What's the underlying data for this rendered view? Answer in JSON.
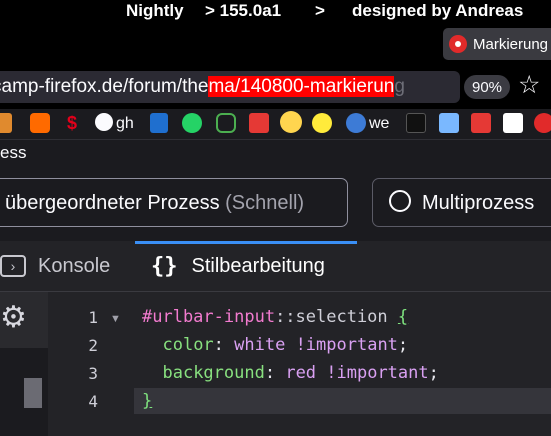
{
  "window": {
    "title_parts": [
      "Nightly",
      "> 155.0a1",
      ">",
      "designed by Andreas"
    ]
  },
  "tab": {
    "label": "Markierung"
  },
  "urlbar": {
    "url_before": "camp-firefox.de/forum/the",
    "url_selected": "ma/140800-markierun",
    "url_after": "g",
    "zoom": "90%"
  },
  "bookmarks": {
    "items": [
      {
        "icon": "folder-icon",
        "color": "#e08a2e"
      },
      {
        "icon": "shop-icon",
        "color": "#ff6a00"
      },
      {
        "icon": "sparkasse-icon",
        "color": "#e2001a"
      },
      {
        "icon": "github-icon",
        "label": "gh"
      },
      {
        "icon": "monitor-icon",
        "color": "#1f6fcf"
      },
      {
        "icon": "whatsapp-icon",
        "color": "#25d366"
      },
      {
        "icon": "leaf-icon",
        "color": "#4caf50"
      },
      {
        "icon": "box-icon",
        "color": "#e53935"
      },
      {
        "icon": "face-icon",
        "color": "#ffd54f"
      },
      {
        "icon": "smiley-icon",
        "color": "#ffeb3b"
      },
      {
        "icon": "globe-icon",
        "label": "we"
      },
      {
        "icon": "cb-icon",
        "color": "#111111"
      },
      {
        "icon": "pencil-icon",
        "color": "#7ab8ff"
      },
      {
        "icon": "red-square-icon",
        "color": "#e53935"
      },
      {
        "icon": "t-icon",
        "color": "#ffffff"
      },
      {
        "icon": "firefox-flame-icon",
        "color": "#e12a2a"
      }
    ]
  },
  "devtools": {
    "header_title": "ess",
    "process": {
      "parent_label": "übergeordneter Prozess",
      "parent_suffix": "(Schnell)",
      "multi_label": "Multiprozess"
    },
    "tabs": [
      {
        "label": "Konsole",
        "active": false
      },
      {
        "label": "Stilbearbeitung",
        "active": true
      }
    ],
    "editor": {
      "line_numbers": [
        "1",
        "2",
        "3",
        "4"
      ],
      "lines": {
        "l1_selector": "#urlbar-input",
        "l1_pseudo": "::selection",
        "l1_brace": "{",
        "l2_prop": "color",
        "l2_value": "white !important",
        "l3_prop": "background",
        "l3_value": "red !important",
        "l4_brace": "}"
      }
    }
  }
}
